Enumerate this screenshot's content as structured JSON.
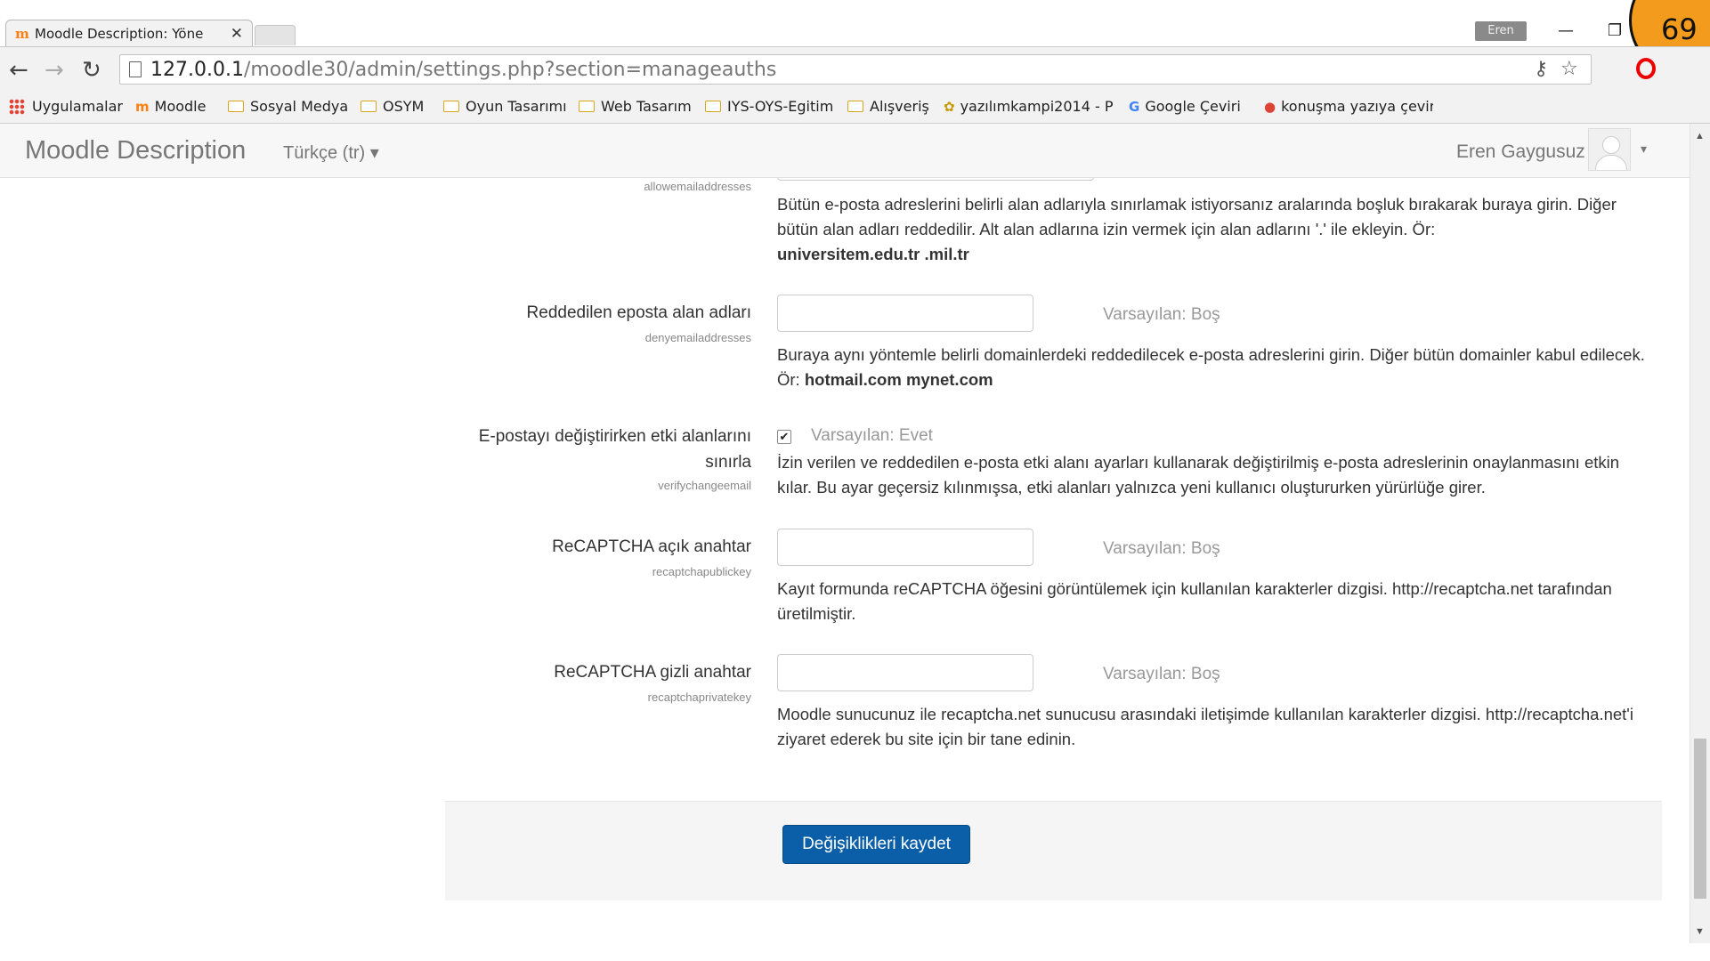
{
  "browser": {
    "tab_title": "Moodle Description: Yöne",
    "tab_close": "✕",
    "profile_name": "Eren",
    "badge_number": "69",
    "url_host": "127.0.0.1",
    "url_path": "/moodle30/admin/settings.php?section=manageauths",
    "bookmarks": [
      {
        "label": "Uygulamalar",
        "icon": "apps-grid-icon"
      },
      {
        "label": "Moodle",
        "icon": "moodle-icon"
      },
      {
        "label": "Sosyal Medya",
        "icon": "folder-icon"
      },
      {
        "label": "OSYM",
        "icon": "folder-icon"
      },
      {
        "label": "Oyun Tasarımı",
        "icon": "folder-icon"
      },
      {
        "label": "Web Tasarım",
        "icon": "folder-icon"
      },
      {
        "label": "IYS-OYS-Egitim",
        "icon": "folder-icon"
      },
      {
        "label": "Alışveriş",
        "icon": "folder-icon"
      },
      {
        "label": "yazılımkampi2014 - P",
        "icon": "site-icon"
      },
      {
        "label": "Google Çeviri",
        "icon": "translate-icon"
      },
      {
        "label": "konuşma yazıya çevir",
        "icon": "chrome-icon"
      }
    ]
  },
  "navbar": {
    "brand": "Moodle Description",
    "language": "Türkçe (tr) ▾",
    "user_name": "Eren Gaygusuz",
    "user_caret": "▾"
  },
  "settings": {
    "allow_key": "allowemailaddresses",
    "allow_desc_1": "Bütün e-posta adreslerini belirli alan adlarıyla sınırlamak istiyorsanız aralarında boşluk bırakarak buraya girin. Diğer bütün alan adları reddedilir. Alt alan adlarına izin vermek için alan adlarını '.' ile ekleyin. Ör:",
    "allow_desc_bold": "universitem.edu.tr .mil.tr",
    "deny_label": "Reddedilen eposta alan adları",
    "deny_key": "denyemailaddresses",
    "deny_default": "Varsayılan: Boş",
    "deny_value": "",
    "deny_desc_1": "Buraya aynı yöntemle belirli domainlerdeki reddedilecek e-posta adreslerini girin. Diğer bütün domainler kabul edilecek. Ör:",
    "deny_desc_bold": "hotmail.com mynet.com",
    "verify_label_1": "E-postayı değiştirirken etki alanlarını",
    "verify_label_2": "sınırla",
    "verify_key": "verifychangeemail",
    "verify_checked": true,
    "verify_default": "Varsayılan: Evet",
    "verify_desc": "İzin verilen ve reddedilen e-posta etki alanı ayarları kullanarak değiştirilmiş e-posta adreslerinin onaylanmasını etkin kılar. Bu ayar geçersiz kılınmışsa, etki alanları yalnızca yeni kullanıcı oluştururken yürürlüğe girer.",
    "recaptcha_pub_label": "ReCAPTCHA açık anahtar",
    "recaptcha_pub_key": "recaptchapublickey",
    "recaptcha_pub_default": "Varsayılan: Boş",
    "recaptcha_pub_value": "",
    "recaptcha_pub_desc": "Kayıt formunda reCAPTCHA öğesini görüntülemek için kullanılan karakterler dizgisi. http://recaptcha.net tarafından üretilmiştir.",
    "recaptcha_priv_label": "ReCAPTCHA gizli anahtar",
    "recaptcha_priv_key": "recaptchaprivatekey",
    "recaptcha_priv_default": "Varsayılan: Boş",
    "recaptcha_priv_value": "",
    "recaptcha_priv_desc": "Moodle sunucunuz ile recaptcha.net sunucusu arasındaki iletişimde kullanılan karakterler dizgisi. http://recaptcha.net'i ziyaret ederek bu site için bir tane edinin."
  },
  "footer": {
    "save_label": "Değişiklikleri kaydet"
  },
  "colors": {
    "accent": "#0a5fa8",
    "badge": "#f39b1c"
  }
}
